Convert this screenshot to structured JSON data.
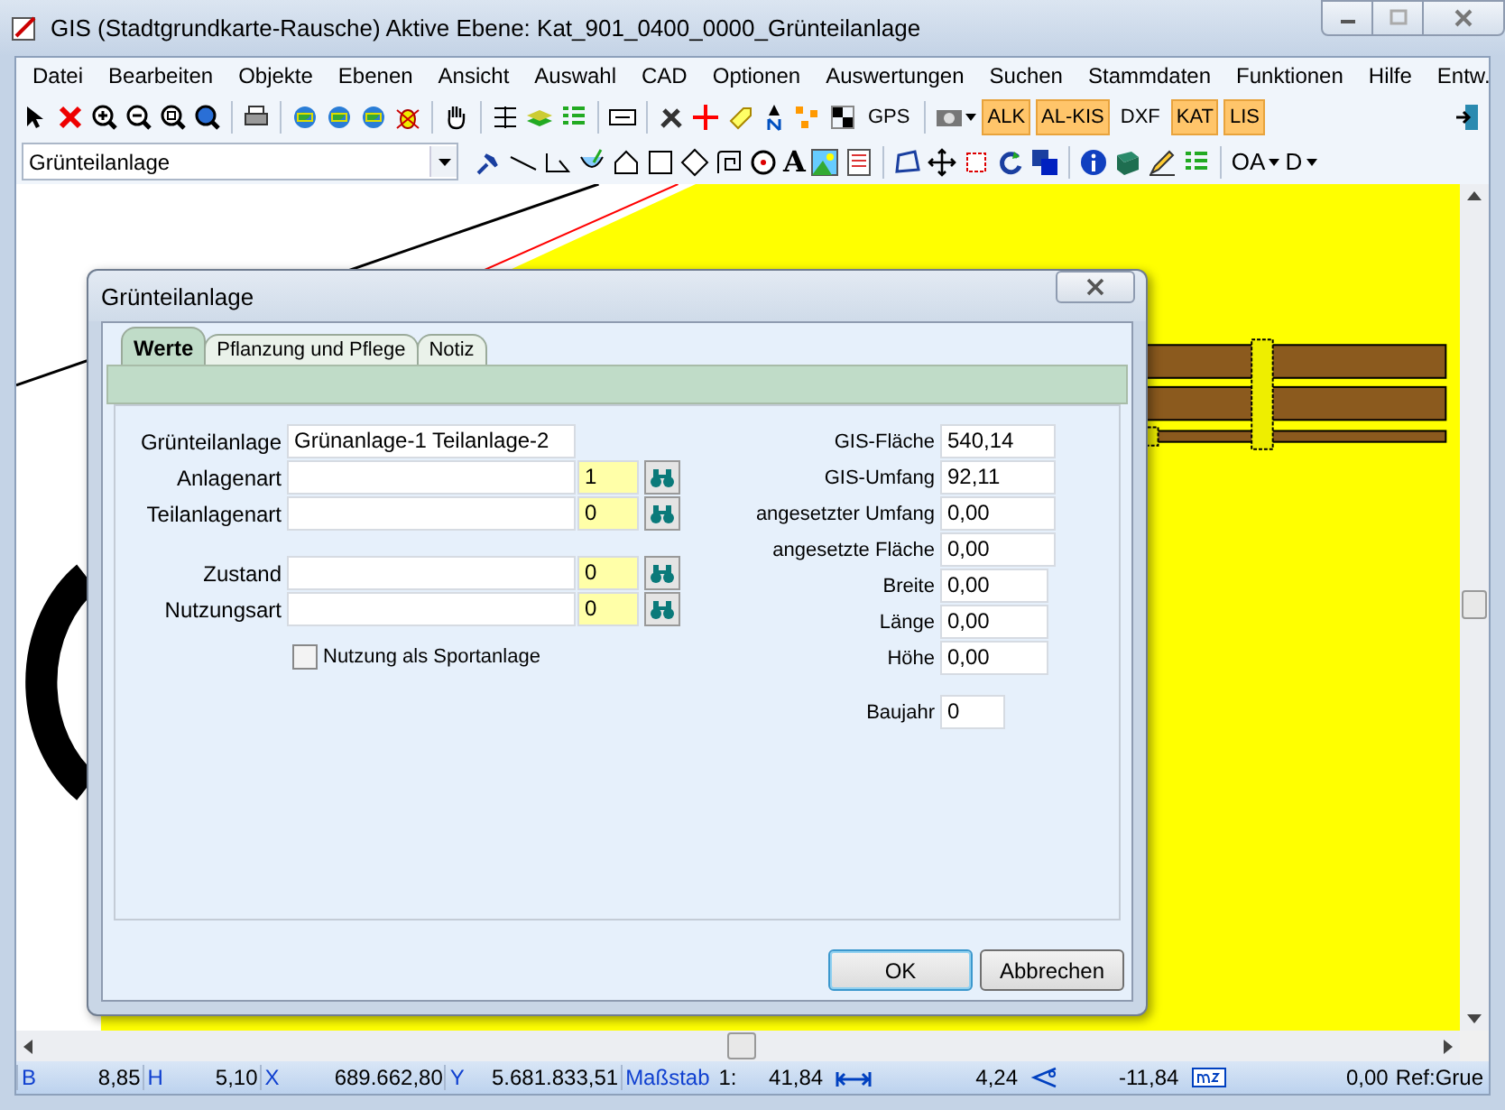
{
  "window": {
    "title": "GIS (Stadtgrundkarte-Rausche) Aktive Ebene: Kat_901_0400_0000_Grünteilanlage"
  },
  "menu": [
    "Datei",
    "Bearbeiten",
    "Objekte",
    "Ebenen",
    "Ansicht",
    "Auswahl",
    "CAD",
    "Optionen",
    "Auswertungen",
    "Suchen",
    "Stammdaten",
    "Funktionen",
    "Hilfe",
    "Entw."
  ],
  "toolbar": {
    "text_buttons": [
      {
        "label": "GPS",
        "selected": false
      },
      {
        "label": "ALK",
        "selected": true
      },
      {
        "label": "AL-KIS",
        "selected": true
      },
      {
        "label": "DXF",
        "selected": false
      },
      {
        "label": "KAT",
        "selected": true
      },
      {
        "label": "LIS",
        "selected": true
      }
    ]
  },
  "toolbar2": {
    "layer_select": "Grünteilanlage",
    "text_tool": "A",
    "menus": [
      "OA",
      "D"
    ]
  },
  "dialog": {
    "title": "Grünteilanlage",
    "tabs": [
      {
        "label": "Werte",
        "selected": true
      },
      {
        "label": "Pflanzung und Pflege",
        "selected": false
      },
      {
        "label": "Notiz",
        "selected": false
      }
    ],
    "left_groups": [
      [
        {
          "kind": "text",
          "label": "Grünteilanlage",
          "value": "Grünanlage-1 Teilanlage-2"
        },
        {
          "kind": "lookup",
          "label": "Anlagenart",
          "code": "1"
        },
        {
          "kind": "lookup",
          "label": "Teilanlagenart",
          "code": "0"
        }
      ],
      [
        {
          "kind": "lookup",
          "label": "Zustand",
          "code": "0"
        },
        {
          "kind": "lookup",
          "label": "Nutzungsart",
          "code": "0"
        }
      ]
    ],
    "checkbox": {
      "label": "Nutzung als Sportanlage",
      "checked": false
    },
    "right_fields": [
      {
        "kind": "measure",
        "label": "GIS-Fläche",
        "value": "540,14"
      },
      {
        "kind": "measure",
        "label": "GIS-Umfang",
        "value": "92,11"
      },
      {
        "kind": "measure",
        "label": "angesetzter Umfang",
        "value": "0,00"
      },
      {
        "kind": "measure",
        "label": "angesetzte Fläche",
        "value": "0,00"
      },
      {
        "kind": "dimension",
        "label": "Breite",
        "value": "0,00"
      },
      {
        "kind": "dimension",
        "label": "Länge",
        "value": "0,00"
      },
      {
        "kind": "dimension",
        "label": "Höhe",
        "value": "0,00"
      },
      {
        "kind": "year",
        "label": "Baujahr",
        "value": "0"
      }
    ],
    "buttons": [
      {
        "label": "OK",
        "default": true
      },
      {
        "label": "Abbrechen",
        "default": false
      }
    ]
  },
  "status_bar": [
    {
      "kind": "label",
      "text": "B"
    },
    {
      "kind": "value",
      "text": "8,85"
    },
    {
      "kind": "label",
      "text": "H"
    },
    {
      "kind": "value",
      "text": "5,10"
    },
    {
      "kind": "label",
      "text": "X"
    },
    {
      "kind": "value",
      "text": "689.662,80"
    },
    {
      "kind": "label",
      "text": "Y"
    },
    {
      "kind": "value",
      "text": "5.681.833,51"
    },
    {
      "kind": "label",
      "text": "Maßstab"
    },
    {
      "kind": "plain",
      "text": "1:"
    },
    {
      "kind": "value",
      "text": "41,84"
    },
    {
      "kind": "measure"
    },
    {
      "kind": "value",
      "text": "4,24"
    },
    {
      "kind": "angle"
    },
    {
      "kind": "value",
      "text": "-11,84"
    },
    {
      "kind": "area"
    },
    {
      "kind": "value",
      "text": "0,00"
    },
    {
      "kind": "plain",
      "text": "Ref:Grue"
    }
  ]
}
